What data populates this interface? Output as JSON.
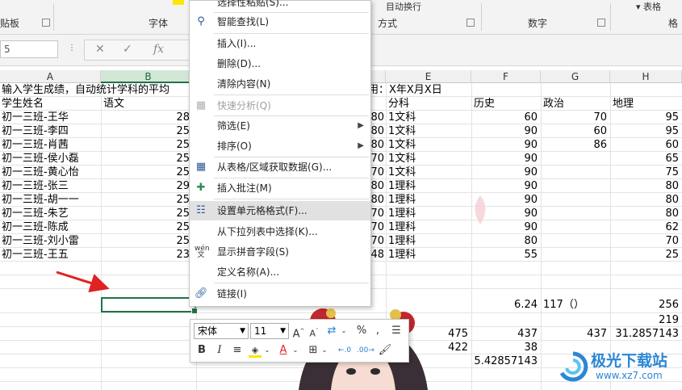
{
  "ribbon": {
    "groups": [
      "贴板",
      "字体",
      "方式",
      "数字"
    ],
    "right_label": "表格",
    "top_right_text": "表格样",
    "cond_text": "目动换行"
  },
  "formula_bar": {
    "name_box": "5",
    "fx": "fx"
  },
  "columns": [
    "A",
    "B",
    "E",
    "F",
    "G",
    "H"
  ],
  "sheet": {
    "title_row": "输入学生成绩，自动统计学科的平均",
    "date_text": "用：X年X月X日",
    "headers": {
      "name": "学生姓名",
      "chinese": "语文",
      "subject": "分科",
      "history": "历史",
      "politics": "政治",
      "geography": "地理"
    },
    "rows": [
      {
        "name": "初一三班-王华",
        "chinese": "28",
        "d": "80",
        "subject": "1文科",
        "history": "60",
        "politics": "70",
        "geography": "95"
      },
      {
        "name": "初一三班-李四",
        "chinese": "25",
        "d": "80",
        "subject": "1文科",
        "history": "90",
        "politics": "60",
        "geography": "95"
      },
      {
        "name": "初一三班-肖茜",
        "chinese": "25",
        "d": "80",
        "subject": "1文科",
        "history": "90",
        "politics": "86",
        "geography": "60"
      },
      {
        "name": "初一三班-侯小磊",
        "chinese": "25",
        "d": "70",
        "subject": "1文科",
        "history": "90",
        "politics": "",
        "geography": "65"
      },
      {
        "name": "初一三班-黄心怡",
        "chinese": "25",
        "d": "70",
        "subject": "1文科",
        "history": "90",
        "politics": "",
        "geography": "75"
      },
      {
        "name": "初一三班-张三",
        "chinese": "29",
        "d": "80",
        "subject": "1理科",
        "history": "90",
        "politics": "",
        "geography": "80"
      },
      {
        "name": "初一三班-胡一一",
        "chinese": "25",
        "d": "80",
        "subject": "1理科",
        "history": "90",
        "politics": "",
        "geography": "80"
      },
      {
        "name": "初一三班-朱艺",
        "chinese": "25",
        "d": "70",
        "subject": "1理科",
        "history": "90",
        "politics": "",
        "geography": "80"
      },
      {
        "name": "初一三班-陈成",
        "chinese": "25",
        "d": "70",
        "subject": "1理科",
        "history": "90",
        "politics": "",
        "geography": "62"
      },
      {
        "name": "初一三班-刘小雷",
        "chinese": "25",
        "d": "70",
        "subject": "1理科",
        "history": "80",
        "politics": "",
        "geography": "70"
      },
      {
        "name": "初一三班-王五",
        "chinese": "23",
        "d": "48",
        "subject": "1理科",
        "history": "55",
        "politics": "",
        "geography": "25"
      }
    ],
    "stats": {
      "f_624": "6.24",
      "g_117": "117（）",
      "h_256": "256",
      "h_219": "219",
      "d_475": "475",
      "f_437": "437",
      "g_437": "437",
      "h_avg": "31.2857143",
      "d_422": "422",
      "f_38": "38",
      "f_avg": "5.42857143"
    }
  },
  "context_menu": {
    "top_partial": "选择性粘贴(S)...",
    "items": [
      {
        "label": "智能查找(L)",
        "icon": "search-icon"
      },
      {
        "label": "插入(I)..."
      },
      {
        "label": "删除(D)..."
      },
      {
        "label": "清除内容(N)"
      },
      {
        "label": "快速分析(Q)",
        "icon": "quick-analysis-icon",
        "disabled": true
      },
      {
        "label": "筛选(E)",
        "submenu": true
      },
      {
        "label": "排序(O)",
        "submenu": true
      },
      {
        "label": "从表格/区域获取数据(G)...",
        "icon": "table-icon"
      },
      {
        "label": "插入批注(M)",
        "icon": "comment-icon"
      },
      {
        "label": "设置单元格格式(F)...",
        "icon": "format-cells-icon",
        "highlighted": true
      },
      {
        "label": "从下拉列表中选择(K)..."
      },
      {
        "label": "显示拼音字段(S)",
        "icon": "pinyin-icon",
        "icon_text": "wén\n文"
      },
      {
        "label": "定义名称(A)..."
      },
      {
        "label": "链接(I)",
        "icon": "link-icon"
      }
    ]
  },
  "mini_toolbar": {
    "font": "宋体",
    "size": "11",
    "bold": "B",
    "italic": "I",
    "percent": "%",
    "comma": ",",
    "inc_font": "A",
    "dec_font": "A",
    "font_color_letter": "A",
    "highlight_color": "#ffe600",
    "font_color": "#e3242b"
  },
  "watermark": {
    "text": "极光下载站",
    "url": "www.xz7.com"
  },
  "colors": {
    "accent": "#217346",
    "arrow": "#e02222"
  }
}
